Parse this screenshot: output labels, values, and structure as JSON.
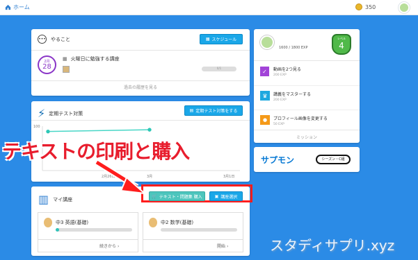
{
  "topbar": {
    "home_label": "ホーム",
    "coins": "350"
  },
  "todo": {
    "title": "やること",
    "schedule_button": "スケジュール",
    "date_month": "2月",
    "date_day": "28",
    "task_title": "火曜日に勉強する講座",
    "task_progress": "0/1",
    "past_link": "過去の履歴を見る"
  },
  "exam": {
    "title": "定期テスト対策",
    "button": "定期テスト対策をする",
    "y_label": "100",
    "dates": [
      "2月26日",
      "3月",
      "3月1日"
    ]
  },
  "overlay": {
    "print_purchase": "テキストの印刷と購入",
    "watermark": "スタディサプリ.xyz"
  },
  "courses": {
    "title": "マイ講座",
    "text_button": "テキスト・問題集 購入",
    "select_button": "講座選択",
    "items": [
      {
        "name": "中3 英語(基礎)",
        "action": "続きから"
      },
      {
        "name": "中2 数学(基礎)",
        "action": "開始"
      }
    ]
  },
  "missions": {
    "exp": "1600 / 1800 EXP",
    "level_label": "レベル",
    "level": "4",
    "items": [
      {
        "title": "動画を2つ見る",
        "exp": "200 EXP"
      },
      {
        "title": "講義をマスターする",
        "exp": "200 EXP"
      },
      {
        "title": "プロフィール画像を変更する",
        "exp": "50 EXP"
      }
    ],
    "footer": "ミッション"
  },
  "banner": {
    "left_logo": "サプモン",
    "right_logo": "シーズン・C組"
  },
  "chart_data": {
    "type": "line",
    "categories": [
      "2月26日",
      "3月",
      "3月1日"
    ],
    "series": [
      {
        "values": [
          88,
          92,
          null
        ]
      }
    ],
    "ylim": [
      0,
      100
    ]
  }
}
